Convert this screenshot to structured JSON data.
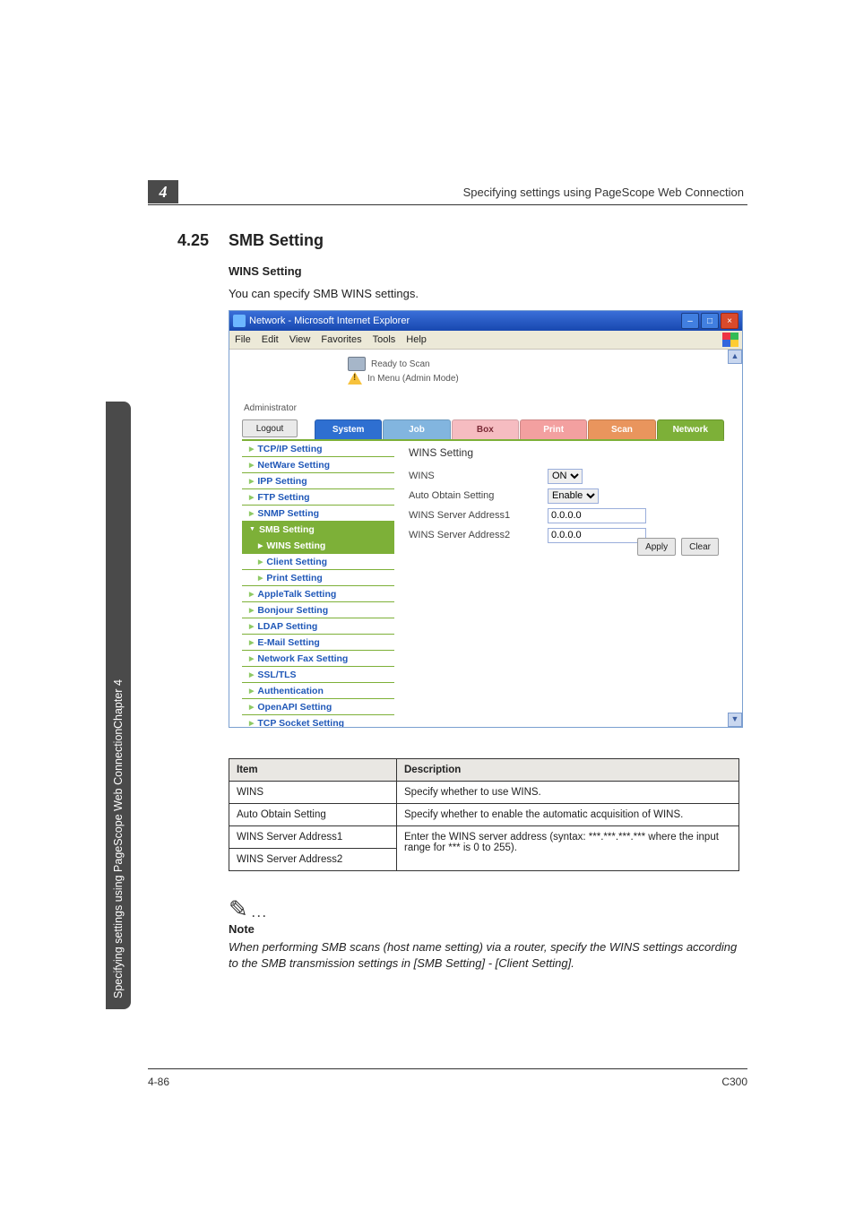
{
  "running_head": "Specifying settings using PageScope Web Connection",
  "chapter_tab": "4",
  "section_number": "4.25",
  "section_title": "SMB Setting",
  "subsection_title": "WINS Setting",
  "subsection_text": "You can specify SMB WINS settings.",
  "side_tab_text": "Specifying settings using PageScope Web Connection",
  "side_tab_chapter": "Chapter 4",
  "screenshot": {
    "window_title": "Network - Microsoft Internet Explorer",
    "menus": {
      "file": "File",
      "edit": "Edit",
      "view": "View",
      "favorites": "Favorites",
      "tools": "Tools",
      "help": "Help"
    },
    "status_line1": "Ready to Scan",
    "status_line2": "In Menu (Admin Mode)",
    "admin_label": "Administrator",
    "logout": "Logout",
    "tabs": {
      "system": "System",
      "job": "Job",
      "box": "Box",
      "print": "Print",
      "scan": "Scan",
      "network": "Network"
    },
    "nav": {
      "tcpip": "TCP/IP Setting",
      "netware": "NetWare Setting",
      "ipp": "IPP Setting",
      "ftp": "FTP Setting",
      "snmp": "SNMP Setting",
      "smb": "SMB Setting",
      "wins": "WINS Setting",
      "client": "Client Setting",
      "printset": "Print Setting",
      "appletalk": "AppleTalk Setting",
      "bonjour": "Bonjour Setting",
      "ldap": "LDAP Setting",
      "email": "E-Mail Setting",
      "netfax": "Network Fax Setting",
      "ssltls": "SSL/TLS",
      "auth": "Authentication",
      "openapi": "OpenAPI Setting",
      "tcpsocket": "TCP Socket Setting"
    },
    "panel": {
      "title": "WINS Setting",
      "wins_label": "WINS",
      "wins_value": "ON",
      "auto_obtain_label": "Auto Obtain Setting",
      "auto_obtain_value": "Enable",
      "addr1_label": "WINS Server Address1",
      "addr1_value": "0.0.0.0",
      "addr2_label": "WINS Server Address2",
      "addr2_value": "0.0.0.0",
      "apply": "Apply",
      "clear": "Clear"
    }
  },
  "table": {
    "h_item": "Item",
    "h_desc": "Description",
    "rows": [
      {
        "item": "WINS",
        "desc": "Specify whether to use WINS."
      },
      {
        "item": "Auto Obtain Setting",
        "desc": "Specify whether to enable the automatic acquisition of WINS."
      },
      {
        "item": "WINS Server Address1",
        "desc": "Enter the WINS server address (syntax: ***.***.***.*** where the input range for *** is 0 to 255)."
      },
      {
        "item": "WINS Server Address2",
        "desc": ""
      }
    ]
  },
  "note": {
    "label": "Note",
    "body": "When performing SMB scans (host name setting) via a router, specify the WINS settings according to the SMB transmission settings in [SMB Setting] - [Client Setting]."
  },
  "footer": {
    "left": "4-86",
    "right": "C300"
  }
}
